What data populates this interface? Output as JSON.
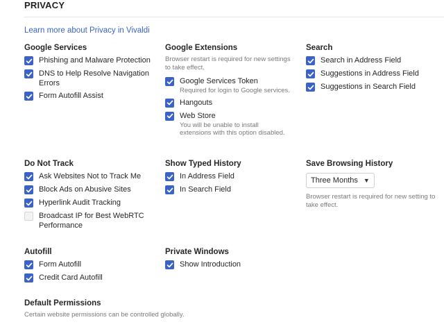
{
  "page": {
    "title": "PRIVACY",
    "learn_more": "Learn more about Privacy in Vivaldi"
  },
  "colors": {
    "accent": "#3a62c9"
  },
  "google_services": {
    "title": "Google Services",
    "items": [
      {
        "label": "Phishing and Malware Protection",
        "checked": true
      },
      {
        "label": "DNS to Help Resolve Navigation Errors",
        "checked": true
      },
      {
        "label": "Form Autofill Assist",
        "checked": true
      }
    ]
  },
  "google_extensions": {
    "title": "Google Extensions",
    "note": "Browser restart is required for new settings to take effect.",
    "items": [
      {
        "label": "Google Services Token",
        "sub": "Required for login to Google services.",
        "checked": true
      },
      {
        "label": "Hangouts",
        "checked": true
      },
      {
        "label": "Web Store",
        "sub": "You will be unable to install extensions with this option disabled.",
        "checked": true
      }
    ]
  },
  "search": {
    "title": "Search",
    "items": [
      {
        "label": "Search in Address Field",
        "checked": true
      },
      {
        "label": "Suggestions in Address Field",
        "checked": true
      },
      {
        "label": "Suggestions in Search Field",
        "checked": true
      }
    ]
  },
  "do_not_track": {
    "title": "Do Not Track",
    "items": [
      {
        "label": "Ask Websites Not to Track Me",
        "checked": true
      },
      {
        "label": "Block Ads on Abusive Sites",
        "checked": true
      },
      {
        "label": "Hyperlink Audit Tracking",
        "checked": true
      },
      {
        "label": "Broadcast IP for Best WebRTC Performance",
        "checked": false
      }
    ]
  },
  "typed_history": {
    "title": "Show Typed History",
    "items": [
      {
        "label": "In Address Field",
        "checked": true
      },
      {
        "label": "In Search Field",
        "checked": true
      }
    ]
  },
  "browsing_history": {
    "title": "Save Browsing History",
    "selected": "Three Months",
    "note": "Browser restart is required for new setting to take effect."
  },
  "autofill": {
    "title": "Autofill",
    "items": [
      {
        "label": "Form Autofill",
        "checked": true
      },
      {
        "label": "Credit Card Autofill",
        "checked": true
      }
    ]
  },
  "private_windows": {
    "title": "Private Windows",
    "items": [
      {
        "label": "Show Introduction",
        "checked": true
      }
    ]
  },
  "default_permissions": {
    "title": "Default Permissions",
    "note": "Certain website permissions can be controlled globally."
  }
}
